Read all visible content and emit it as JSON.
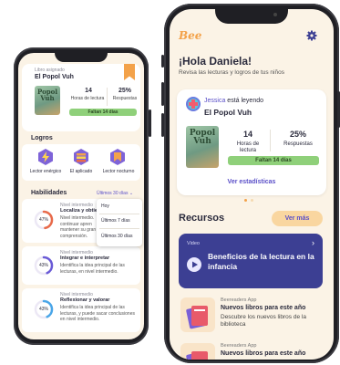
{
  "left_phone": {
    "card": {
      "label": "Libro asignado",
      "title": "El Popol Vuh",
      "cover_title": "Popol Vuh",
      "hours_value": "14",
      "hours_label": "Horas de lectura",
      "answers_value": "25%",
      "answers_label": "Respuestas",
      "remaining": "Faltan 14 días"
    },
    "achievements": {
      "heading": "Logros",
      "items": [
        {
          "label": "Lector enérgico",
          "icon": "lightning-icon"
        },
        {
          "label": "El aplicado",
          "icon": "books-icon"
        },
        {
          "label": "Lector nocturno",
          "icon": "bookmark-icon"
        }
      ]
    },
    "skills": {
      "heading": "Habilidades",
      "filter_label": "Últimos 30 días",
      "filter_chevron": "⌄",
      "dropdown_options": [
        "Hoy",
        "Últimos 7 días",
        "Últimos 30 días"
      ],
      "items": [
        {
          "percent": "47%",
          "level": "Nivel intermedio",
          "title": "Localiza y obtiene",
          "desc": "Nivel intermedio. continuar apren mantener su gran comprensión."
        },
        {
          "percent": "43%",
          "level": "Nivel intermedio",
          "title": "Integrar e interpretar",
          "desc": "Identifica la idea principal de las lecturas, en nivel intermedio."
        },
        {
          "percent": "43%",
          "level": "Nivel intermedio",
          "title": "Reflexionar y valorar",
          "desc": "Identifica la idea principal de las lecturas, y puede sacar conclusiones en nivel intermedio."
        }
      ],
      "ring_values": [
        0.47,
        0.43,
        0.43
      ]
    }
  },
  "right_phone": {
    "logo": "Bee",
    "greeting": "¡Hola Daniela!",
    "subtitle": "Revisa las lecturas y logros de tus niños",
    "reading_card": {
      "child_name": "Jessica",
      "status": "está leyendo",
      "book_title": "El Popol Vuh",
      "cover_title": "Popol Vuh",
      "hours_value": "14",
      "hours_label": "Horas de lectura",
      "answers_value": "25%",
      "answers_label": "Respuestas",
      "remaining": "Faltan 14 días",
      "stats_link": "Ver estadísticas"
    },
    "resources": {
      "heading": "Recursos",
      "see_more": "Ver más",
      "video": {
        "tag": "Video",
        "title": "Beneficios de la lectura en la infancia",
        "arrow": "›"
      },
      "items": [
        {
          "source": "Beereaders App",
          "title": "Nuevos libros para este año",
          "desc": "Descubre los nuevos libros de la biblioteca"
        },
        {
          "source": "Beereaders App",
          "title": "Nuevos libros para este año",
          "desc": ""
        }
      ]
    }
  },
  "colors": {
    "accent_orange": "#f3a24a",
    "purple": "#3c3f93",
    "link_purple": "#5a4fc8",
    "green": "#8fd07a"
  }
}
